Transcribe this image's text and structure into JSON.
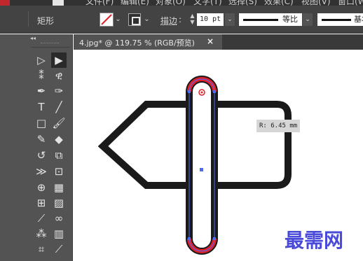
{
  "menubar": {
    "items": [
      "文件(F)",
      "编辑(E)",
      "对象(O)",
      "文字(T)",
      "选择(S)",
      "效果(C)",
      "视图(V)",
      "窗口(W)"
    ]
  },
  "controlbar": {
    "object_type": "矩形",
    "stroke_label": "描边",
    "stroke_weight": "10 pt",
    "line_style_1": "等比",
    "line_style_2": "基本"
  },
  "document_tab": {
    "title": "4.jpg* @ 119.75 % (RGB/预览)",
    "close": "×"
  },
  "canvas": {
    "tooltip": "R: 6.45 mm",
    "watermark": "最需网"
  },
  "colors": {
    "ui_dark": "#323232",
    "panel": "#535353",
    "selection": "#4a6cf7",
    "handle_red": "#e0202a",
    "watermark": "#4a4ad8"
  },
  "tools": [
    "selection-tool",
    "direct-selection-tool",
    "magic-wand-tool",
    "lasso-tool",
    "pen-tool",
    "curvature-tool",
    "type-tool",
    "line-tool",
    "rectangle-tool",
    "paintbrush-tool",
    "shaper-tool",
    "eraser-tool",
    "rotate-tool",
    "scale-tool",
    "width-tool",
    "free-transform-tool",
    "shape-builder-tool",
    "perspective-grid-tool",
    "mesh-tool",
    "gradient-tool",
    "eyedropper-tool",
    "blend-tool",
    "symbol-sprayer-tool",
    "column-graph-tool",
    "artboard-tool",
    "slice-tool"
  ]
}
